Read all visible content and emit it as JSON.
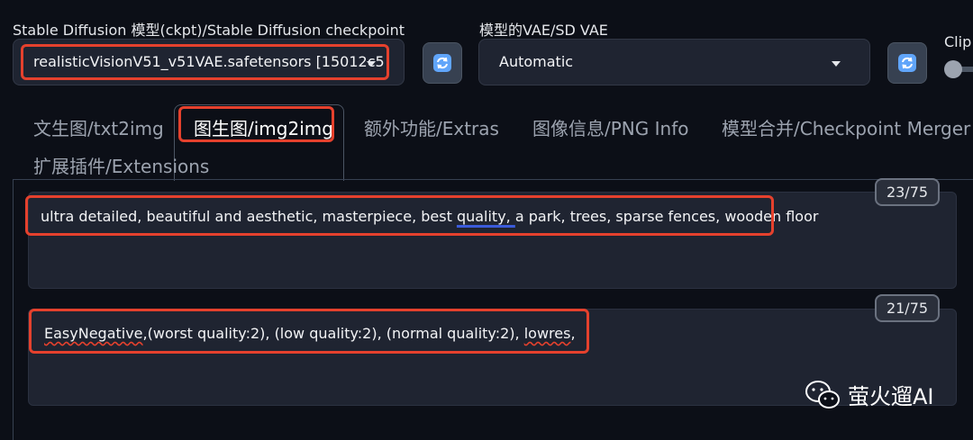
{
  "checkpoint": {
    "label": "Stable Diffusion 模型(ckpt)/Stable Diffusion checkpoint",
    "value": "realisticVisionV51_v51VAE.safetensors [15012c5"
  },
  "vae": {
    "label": "模型的VAE/SD VAE",
    "value": "Automatic"
  },
  "clip": {
    "label": "Clip"
  },
  "tabs": [
    {
      "label": "文生图/txt2img"
    },
    {
      "label": "图生图/img2img"
    },
    {
      "label": "额外功能/Extras"
    },
    {
      "label": "图像信息/PNG Info"
    },
    {
      "label": "模型合并/Checkpoint Merger"
    },
    {
      "label": "扩展插件/Extensions"
    }
  ],
  "positive_prompt": {
    "pre": "ultra detailed, beautiful and aesthetic, masterpiece, best ",
    "underlined": "quality, ",
    "post": " a park, trees, sparse fences, wooden floor",
    "token_count": "23/75"
  },
  "negative_prompt": {
    "underlined1": "EasyNegative",
    "mid": ",(worst quality:2), (low quality:2), (normal quality:2), ",
    "underlined2": "lowres",
    "end": ",",
    "token_count": "21/75"
  },
  "watermark": {
    "text": "萤火遛AI",
    "icon": "wechat-icon"
  },
  "colors": {
    "highlight": "#e5412d",
    "background": "#0c0f17",
    "field": "#1f2431"
  }
}
